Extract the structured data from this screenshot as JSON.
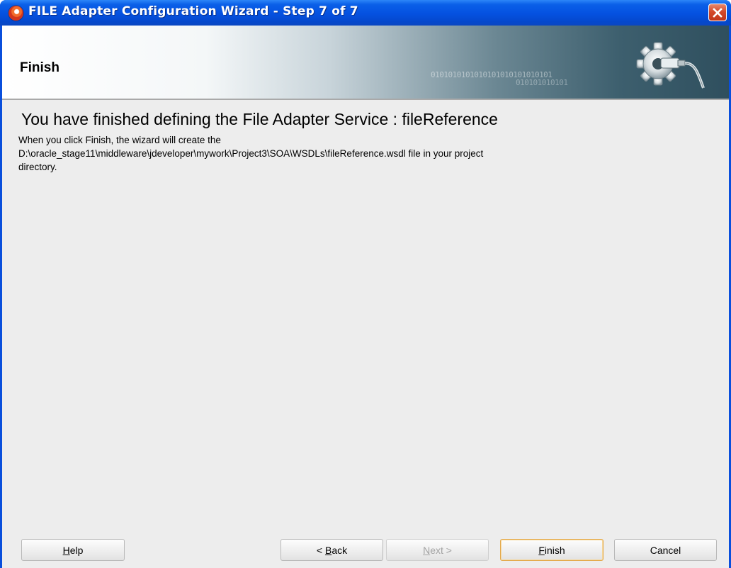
{
  "window": {
    "title": "FILE Adapter Configuration Wizard - Step 7 of 7",
    "app_icon": "oracle-jdeveloper-icon",
    "close_icon": "close-icon"
  },
  "header": {
    "title": "Finish",
    "decoration_binary_1": "0101010101010101010101010101",
    "decoration_binary_2": "010101010101",
    "graphic_icon": "gear-plug-icon"
  },
  "main": {
    "heading": "You have finished defining the File Adapter Service : fileReference",
    "description_lines": [
      "When you click Finish, the wizard will create the",
      "D:\\oracle_stage11\\middleware\\jdeveloper\\mywork\\Project3\\SOA\\WSDLs\\fileReference.wsdl file in your project",
      "directory."
    ]
  },
  "buttons": {
    "help": {
      "mnemonic": "H",
      "rest": "elp"
    },
    "back": {
      "prefix": "< ",
      "mnemonic": "B",
      "rest": "ack"
    },
    "next": {
      "mnemonic": "N",
      "rest": "ext >"
    },
    "finish": {
      "mnemonic": "F",
      "rest": "inish"
    },
    "cancel": {
      "label": "Cancel"
    }
  },
  "colors": {
    "titlebar": "#0551e0",
    "content_bg": "#ededed",
    "default_button_border": "#e3a84a"
  }
}
